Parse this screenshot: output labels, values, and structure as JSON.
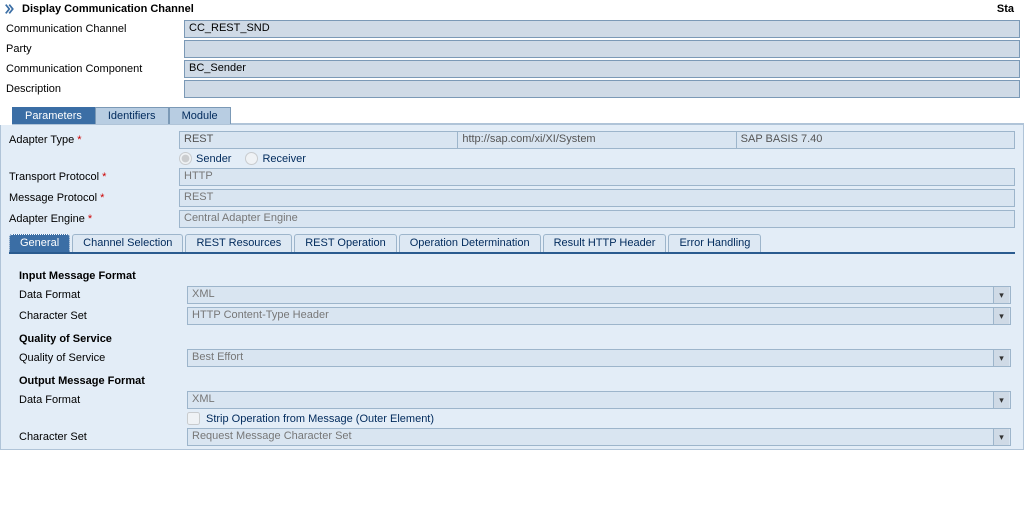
{
  "page": {
    "title": "Display Communication Channel",
    "status_right": "Sta"
  },
  "header": {
    "labels": {
      "channel": "Communication Channel",
      "party": "Party",
      "component": "Communication Component",
      "description": "Description"
    },
    "values": {
      "channel": "CC_REST_SND",
      "party": "",
      "component": "BC_Sender",
      "description": ""
    }
  },
  "tabs_main": [
    "Parameters",
    "Identifiers",
    "Module"
  ],
  "params": {
    "labels": {
      "adapter_type": "Adapter Type",
      "sender": "Sender",
      "receiver": "Receiver",
      "transport": "Transport Protocol",
      "message": "Message Protocol",
      "engine": "Adapter Engine"
    },
    "adapter_type": {
      "name": "REST",
      "namespace": "http://sap.com/xi/XI/System",
      "swcv": "SAP BASIS 7.40"
    },
    "direction": "Sender",
    "transport": "HTTP",
    "message": "REST",
    "engine": "Central Adapter Engine"
  },
  "tabs_sub": [
    "General",
    "Channel Selection",
    "REST Resources",
    "REST Operation",
    "Operation Determination",
    "Result HTTP Header",
    "Error Handling"
  ],
  "sections": {
    "input_h": "Input Message Format",
    "qos_h": "Quality of Service",
    "output_h": "Output Message Format",
    "labels": {
      "data_format": "Data Format",
      "charset": "Character Set",
      "qos": "Quality of Service",
      "strip": "Strip Operation from Message (Outer Element)"
    },
    "input": {
      "data_format": "XML",
      "charset": "HTTP Content-Type Header"
    },
    "qos": {
      "value": "Best Effort"
    },
    "output": {
      "data_format": "XML",
      "strip": false,
      "charset": "Request Message Character Set"
    }
  }
}
